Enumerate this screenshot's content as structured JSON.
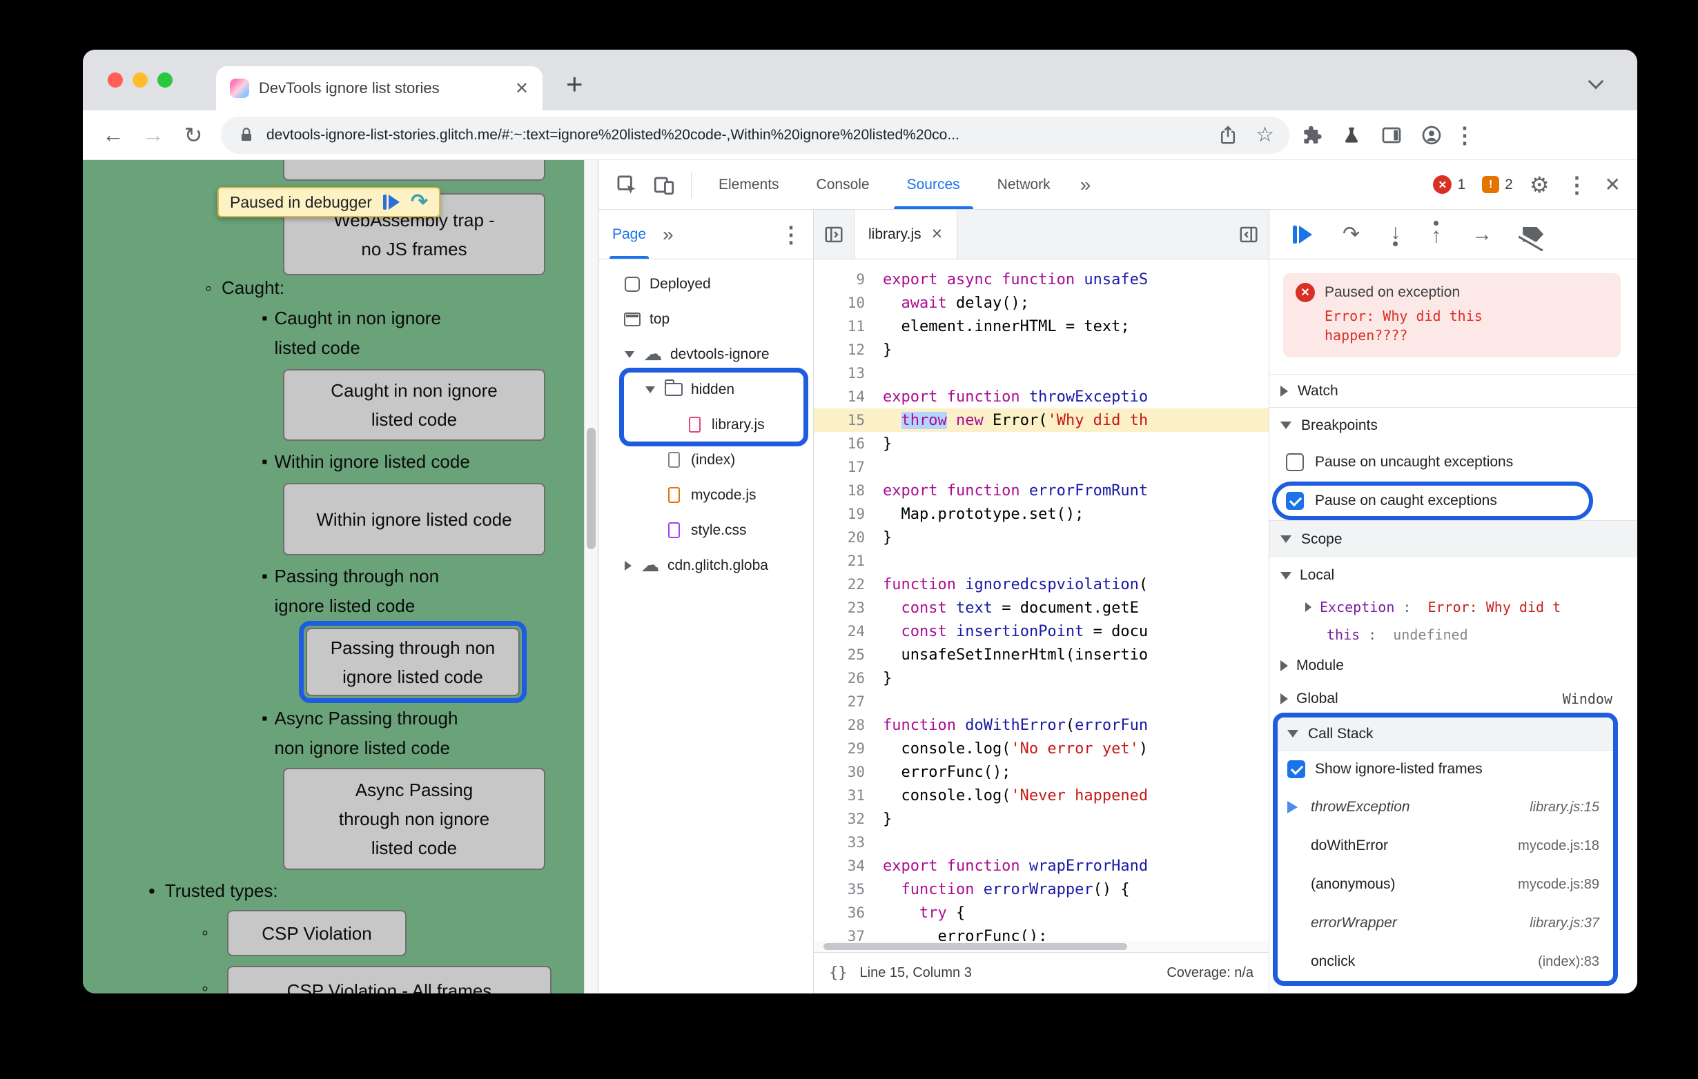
{
  "colors": {
    "accent_blue": "#1a73e8",
    "annotation_ring_blue": "#1f5de0",
    "page_background_green": "#6aa379",
    "paused_chip_yellow": "#fdf2c4",
    "error_red": "#d93025",
    "warning_orange": "#e37400",
    "exec_line_yellow": "#fbf0c7"
  },
  "icons": {
    "close": "✕",
    "plus": "+",
    "back": "←",
    "forward": "→",
    "reload": "↻",
    "star": "☆",
    "cloud": "☁",
    "overflow_chevrons": "»",
    "more_vertical": "⋮",
    "settings_gear": "⚙",
    "step_over": "↷",
    "step_into": "↓",
    "step_out": "↑",
    "step": "→",
    "braces": "{}",
    "bullet_disc": "•",
    "bullet_circle": "◦",
    "bullet_square": "▪",
    "warning_mark": "!"
  },
  "browser": {
    "tab_title": "DevTools ignore list stories",
    "url": "devtools-ignore-list-stories.glitch.me/#:~:text=ignore%20listed%20code-,Within%20ignore%20listed%20co..."
  },
  "page": {
    "chip_label": "Paused in debugger",
    "wasm_button": "WebAssembly trap - no JS frames",
    "caught_label": "Caught:",
    "items": [
      {
        "label": "Caught in non ignore listed code",
        "button": "Caught in non ignore listed code",
        "ring": false
      },
      {
        "label": "Within ignore listed code",
        "button": "Within ignore listed code",
        "ring": false
      },
      {
        "label": "Passing through non ignore listed code",
        "button": "Passing through non ignore listed code",
        "ring": true
      },
      {
        "label": "Async Passing through non ignore listed code",
        "button": "Async Passing through non ignore listed code",
        "ring": false
      }
    ],
    "trusted_label": "Trusted types:",
    "csp_items": [
      "CSP Violation",
      "CSP Violation - All frames"
    ]
  },
  "devtools": {
    "tabs": [
      "Elements",
      "Console",
      "Sources",
      "Network"
    ],
    "active_tab": "Sources",
    "error_count": "1",
    "warning_count": "2",
    "navigator": {
      "tab_label": "Page",
      "tree": [
        {
          "depth": 0,
          "icon": "deployed",
          "label": "Deployed"
        },
        {
          "depth": 0,
          "icon": "frame",
          "label": "top"
        },
        {
          "depth": 1,
          "expand": "open",
          "icon": "cloud",
          "label": "devtools-ignore"
        },
        {
          "depth": 2,
          "expand": "open",
          "icon": "folder",
          "label": "hidden",
          "ring": true
        },
        {
          "depth": 3,
          "icon": "file-pink",
          "label": "library.js",
          "ring": true
        },
        {
          "depth": 2,
          "icon": "file-gray",
          "label": "(index)"
        },
        {
          "depth": 2,
          "icon": "file-orange",
          "label": "mycode.js"
        },
        {
          "depth": 2,
          "icon": "file-purple",
          "label": "style.css"
        },
        {
          "depth": 1,
          "expand": "closed",
          "icon": "cloud",
          "label": "cdn.glitch.globa"
        }
      ]
    },
    "editor": {
      "tab_label": "library.js",
      "status_position": "Line 15, Column 3",
      "status_coverage": "Coverage: n/a",
      "lines": [
        {
          "n": 9,
          "t": [
            [
              "export async function ",
              "k"
            ],
            [
              "unsafeS",
              "b"
            ]
          ]
        },
        {
          "n": 10,
          "t": [
            [
              "  ",
              "x"
            ],
            [
              "await",
              "k"
            ],
            [
              " delay();",
              "x"
            ]
          ]
        },
        {
          "n": 11,
          "t": [
            [
              "  element.innerHTML = text;",
              "x"
            ]
          ]
        },
        {
          "n": 12,
          "t": [
            [
              "}",
              "x"
            ]
          ]
        },
        {
          "n": 13,
          "t": []
        },
        {
          "n": 14,
          "t": [
            [
              "export function ",
              "k"
            ],
            [
              "throwExceptio",
              "b"
            ]
          ]
        },
        {
          "n": 15,
          "exec": true,
          "t": [
            [
              "  ",
              "x"
            ],
            [
              "throw",
              "k sel"
            ],
            [
              " ",
              "x"
            ],
            [
              "new",
              "k"
            ],
            [
              " Error(",
              "x"
            ],
            [
              "'Why did th",
              "s"
            ]
          ]
        },
        {
          "n": 16,
          "t": [
            [
              "}",
              "x"
            ]
          ]
        },
        {
          "n": 17,
          "t": []
        },
        {
          "n": 18,
          "t": [
            [
              "export function ",
              "k"
            ],
            [
              "errorFromRunt",
              "b"
            ]
          ]
        },
        {
          "n": 19,
          "t": [
            [
              "  Map.prototype.set();",
              "x"
            ]
          ]
        },
        {
          "n": 20,
          "t": [
            [
              "}",
              "x"
            ]
          ]
        },
        {
          "n": 21,
          "t": []
        },
        {
          "n": 22,
          "t": [
            [
              "function ",
              "k"
            ],
            [
              "ignoredcspviolation",
              "b"
            ],
            [
              "(",
              "x"
            ]
          ]
        },
        {
          "n": 23,
          "t": [
            [
              "  ",
              "x"
            ],
            [
              "const",
              "k"
            ],
            [
              " ",
              "x"
            ],
            [
              "text",
              "b"
            ],
            [
              " = document.getE",
              "x"
            ]
          ]
        },
        {
          "n": 24,
          "t": [
            [
              "  ",
              "x"
            ],
            [
              "const",
              "k"
            ],
            [
              " ",
              "x"
            ],
            [
              "insertionPoint",
              "b"
            ],
            [
              " = docu",
              "x"
            ]
          ]
        },
        {
          "n": 25,
          "t": [
            [
              "  unsafeSetInnerHtml(insertio",
              "x"
            ]
          ]
        },
        {
          "n": 26,
          "t": [
            [
              "}",
              "x"
            ]
          ]
        },
        {
          "n": 27,
          "t": []
        },
        {
          "n": 28,
          "t": [
            [
              "function ",
              "k"
            ],
            [
              "doWithError",
              "b"
            ],
            [
              "(",
              "x"
            ],
            [
              "errorFun",
              "b"
            ]
          ]
        },
        {
          "n": 29,
          "t": [
            [
              "  console.log(",
              "x"
            ],
            [
              "'No error yet'",
              "s"
            ],
            [
              ")",
              "x"
            ]
          ]
        },
        {
          "n": 30,
          "t": [
            [
              "  errorFunc();",
              "x"
            ]
          ]
        },
        {
          "n": 31,
          "t": [
            [
              "  console.log(",
              "x"
            ],
            [
              "'Never happened",
              "s"
            ]
          ]
        },
        {
          "n": 32,
          "t": [
            [
              "}",
              "x"
            ]
          ]
        },
        {
          "n": 33,
          "t": []
        },
        {
          "n": 34,
          "t": [
            [
              "export function ",
              "k"
            ],
            [
              "wrapErrorHand",
              "b"
            ]
          ]
        },
        {
          "n": 35,
          "t": [
            [
              "  ",
              "x"
            ],
            [
              "function ",
              "k"
            ],
            [
              "errorWrapper",
              "b"
            ],
            [
              "() {",
              "x"
            ]
          ]
        },
        {
          "n": 36,
          "t": [
            [
              "    ",
              "x"
            ],
            [
              "try",
              "k"
            ],
            [
              " {",
              "x"
            ]
          ]
        },
        {
          "n": 37,
          "t": [
            [
              "      errorFunc();",
              "x"
            ]
          ]
        }
      ]
    },
    "debugger": {
      "paused_title": "Paused on exception",
      "paused_message": "Error: Why did this happen????",
      "watch_label": "Watch",
      "breakpoints_label": "Breakpoints",
      "pause_uncaught_label": "Pause on uncaught exceptions",
      "pause_caught_label": "Pause on caught exceptions",
      "scope_label": "Scope",
      "scope_local_label": "Local",
      "name_value_sep": ": ",
      "exception_name": "Exception",
      "exception_value": "Error: Why did t",
      "this_name": "this",
      "this_value": "undefined",
      "module_label": "Module",
      "global_label": "Global",
      "global_value": "Window",
      "callstack_label": "Call Stack",
      "show_ignore_label": "Show ignore-listed frames",
      "frames": [
        {
          "name": "throwException",
          "loc": "library.js:15",
          "current": true,
          "ignore_listed": true
        },
        {
          "name": "doWithError",
          "loc": "mycode.js:18"
        },
        {
          "name": "(anonymous)",
          "loc": "mycode.js:89"
        },
        {
          "name": "errorWrapper",
          "loc": "library.js:37",
          "ignore_listed": true
        },
        {
          "name": "onclick",
          "loc": "(index):83"
        }
      ]
    }
  }
}
